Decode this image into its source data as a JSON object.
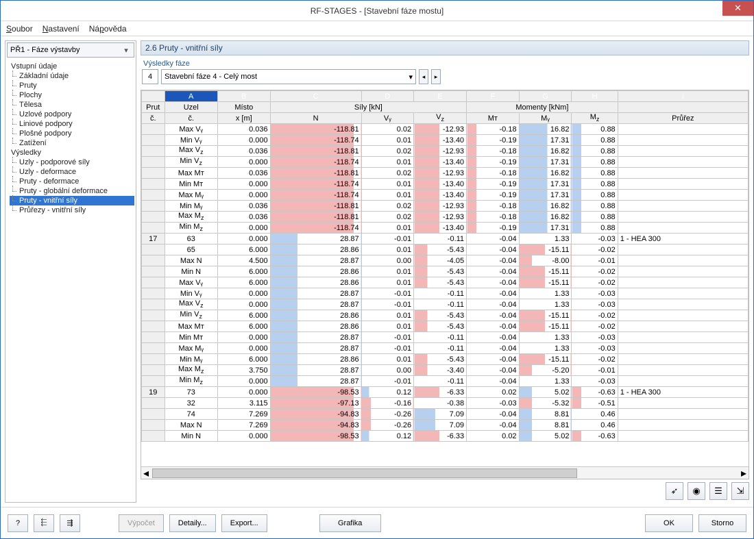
{
  "window": {
    "title": "RF-STAGES - [Stavební fáze mostu]"
  },
  "menu": {
    "file": "Soubor",
    "settings": "Nastavení",
    "help": "Nápověda"
  },
  "leftpane": {
    "combo": "PŘ1 - Fáze výstavby",
    "tree": {
      "input_root": "Vstupní údaje",
      "input_items": [
        "Základní údaje",
        "Pruty",
        "Plochy",
        "Tělesa",
        "Uzlové podpory",
        "Liniové podpory",
        "Plošné podpory",
        "Zatížení"
      ],
      "results_root": "Výsledky",
      "results_items": [
        "Uzly - podporové síly",
        "Uzly - deformace",
        "Pruty - deformace",
        "Pruty - globální deformace",
        "Pruty - vnitřní síly",
        "Průřezy - vnitřní síly"
      ],
      "selected": "Pruty - vnitřní síly"
    }
  },
  "panel": {
    "header": "2.6 Pruty - vnitřní síly",
    "phase_label": "Výsledky fáze",
    "phase_num": "4",
    "phase_name": "Stavební fáze 4 - Celý most"
  },
  "grid": {
    "colletters": [
      "A",
      "B",
      "C",
      "D",
      "E",
      "F",
      "G",
      "H",
      "I"
    ],
    "group_headers": {
      "prut": "Prut",
      "uzel": "Uzel",
      "misto": "Místo",
      "sily": "Síly [kN]",
      "momenty": "Momenty [kNm]",
      "prurez_blank": ""
    },
    "sub_headers": {
      "prut_c": "č.",
      "uzel_c": "č.",
      "misto_x": "x [m]",
      "N": "N",
      "Vy": "Vᵧ",
      "Vz": "V_z",
      "MT": "Mᴛ",
      "My": "Mᵧ",
      "Mz": "M_z",
      "prurez": "Průřez"
    },
    "rows": [
      {
        "prut": "",
        "uzel": "Max Vᵧ",
        "x": "0.036",
        "N": "-118.81",
        "Vy": "0.02",
        "Vz": "-12.93",
        "MT": "-0.18",
        "My": "16.82",
        "Mz": "0.88",
        "prurez": ""
      },
      {
        "prut": "",
        "uzel": "Min Vᵧ",
        "x": "0.000",
        "N": "-118.74",
        "Vy": "0.01",
        "Vz": "-13.40",
        "MT": "-0.19",
        "My": "17.31",
        "Mz": "0.88",
        "prurez": ""
      },
      {
        "prut": "",
        "uzel": "Max V_z",
        "x": "0.036",
        "N": "-118.81",
        "Vy": "0.02",
        "Vz": "-12.93",
        "MT": "-0.18",
        "My": "16.82",
        "Mz": "0.88",
        "prurez": ""
      },
      {
        "prut": "",
        "uzel": "Min V_z",
        "x": "0.000",
        "N": "-118.74",
        "Vy": "0.01",
        "Vz": "-13.40",
        "MT": "-0.19",
        "My": "17.31",
        "Mz": "0.88",
        "prurez": ""
      },
      {
        "prut": "",
        "uzel": "Max Mᴛ",
        "x": "0.036",
        "N": "-118.81",
        "Vy": "0.02",
        "Vz": "-12.93",
        "MT": "-0.18",
        "My": "16.82",
        "Mz": "0.88",
        "prurez": ""
      },
      {
        "prut": "",
        "uzel": "Min Mᴛ",
        "x": "0.000",
        "N": "-118.74",
        "Vy": "0.01",
        "Vz": "-13.40",
        "MT": "-0.19",
        "My": "17.31",
        "Mz": "0.88",
        "prurez": ""
      },
      {
        "prut": "",
        "uzel": "Max Mᵧ",
        "x": "0.000",
        "N": "-118.74",
        "Vy": "0.01",
        "Vz": "-13.40",
        "MT": "-0.19",
        "My": "17.31",
        "Mz": "0.88",
        "prurez": ""
      },
      {
        "prut": "",
        "uzel": "Min Mᵧ",
        "x": "0.036",
        "N": "-118.81",
        "Vy": "0.02",
        "Vz": "-12.93",
        "MT": "-0.18",
        "My": "16.82",
        "Mz": "0.88",
        "prurez": ""
      },
      {
        "prut": "",
        "uzel": "Max M_z",
        "x": "0.036",
        "N": "-118.81",
        "Vy": "0.02",
        "Vz": "-12.93",
        "MT": "-0.18",
        "My": "16.82",
        "Mz": "0.88",
        "prurez": ""
      },
      {
        "prut": "",
        "uzel": "Min M_z",
        "x": "0.000",
        "N": "-118.74",
        "Vy": "0.01",
        "Vz": "-13.40",
        "MT": "-0.19",
        "My": "17.31",
        "Mz": "0.88",
        "prurez": ""
      },
      {
        "prut": "17",
        "uzel": "63",
        "x": "0.000",
        "N": "28.87",
        "Vy": "-0.01",
        "Vz": "-0.11",
        "MT": "-0.04",
        "My": "1.33",
        "Mz": "-0.03",
        "prurez": "1 - HEA 300"
      },
      {
        "prut": "",
        "uzel": "65",
        "x": "6.000",
        "N": "28.86",
        "Vy": "0.01",
        "Vz": "-5.43",
        "MT": "-0.04",
        "My": "-15.11",
        "Mz": "-0.02",
        "prurez": ""
      },
      {
        "prut": "",
        "uzel": "Max N",
        "x": "4.500",
        "N": "28.87",
        "Vy": "0.00",
        "Vz": "-4.05",
        "MT": "-0.04",
        "My": "-8.00",
        "Mz": "-0.01",
        "prurez": ""
      },
      {
        "prut": "",
        "uzel": "Min N",
        "x": "6.000",
        "N": "28.86",
        "Vy": "0.01",
        "Vz": "-5.43",
        "MT": "-0.04",
        "My": "-15.11",
        "Mz": "-0.02",
        "prurez": ""
      },
      {
        "prut": "",
        "uzel": "Max Vᵧ",
        "x": "6.000",
        "N": "28.86",
        "Vy": "0.01",
        "Vz": "-5.43",
        "MT": "-0.04",
        "My": "-15.11",
        "Mz": "-0.02",
        "prurez": ""
      },
      {
        "prut": "",
        "uzel": "Min Vᵧ",
        "x": "0.000",
        "N": "28.87",
        "Vy": "-0.01",
        "Vz": "-0.11",
        "MT": "-0.04",
        "My": "1.33",
        "Mz": "-0.03",
        "prurez": ""
      },
      {
        "prut": "",
        "uzel": "Max V_z",
        "x": "0.000",
        "N": "28.87",
        "Vy": "-0.01",
        "Vz": "-0.11",
        "MT": "-0.04",
        "My": "1.33",
        "Mz": "-0.03",
        "prurez": ""
      },
      {
        "prut": "",
        "uzel": "Min V_z",
        "x": "6.000",
        "N": "28.86",
        "Vy": "0.01",
        "Vz": "-5.43",
        "MT": "-0.04",
        "My": "-15.11",
        "Mz": "-0.02",
        "prurez": ""
      },
      {
        "prut": "",
        "uzel": "Max Mᴛ",
        "x": "6.000",
        "N": "28.86",
        "Vy": "0.01",
        "Vz": "-5.43",
        "MT": "-0.04",
        "My": "-15.11",
        "Mz": "-0.02",
        "prurez": ""
      },
      {
        "prut": "",
        "uzel": "Min Mᴛ",
        "x": "0.000",
        "N": "28.87",
        "Vy": "-0.01",
        "Vz": "-0.11",
        "MT": "-0.04",
        "My": "1.33",
        "Mz": "-0.03",
        "prurez": ""
      },
      {
        "prut": "",
        "uzel": "Max Mᵧ",
        "x": "0.000",
        "N": "28.87",
        "Vy": "-0.01",
        "Vz": "-0.11",
        "MT": "-0.04",
        "My": "1.33",
        "Mz": "-0.03",
        "prurez": ""
      },
      {
        "prut": "",
        "uzel": "Min Mᵧ",
        "x": "6.000",
        "N": "28.86",
        "Vy": "0.01",
        "Vz": "-5.43",
        "MT": "-0.04",
        "My": "-15.11",
        "Mz": "-0.02",
        "prurez": ""
      },
      {
        "prut": "",
        "uzel": "Max M_z",
        "x": "3.750",
        "N": "28.87",
        "Vy": "0.00",
        "Vz": "-3.40",
        "MT": "-0.04",
        "My": "-5.20",
        "Mz": "-0.01",
        "prurez": ""
      },
      {
        "prut": "",
        "uzel": "Min M_z",
        "x": "0.000",
        "N": "28.87",
        "Vy": "-0.01",
        "Vz": "-0.11",
        "MT": "-0.04",
        "My": "1.33",
        "Mz": "-0.03",
        "prurez": ""
      },
      {
        "prut": "19",
        "uzel": "73",
        "x": "0.000",
        "N": "-98.53",
        "Vy": "0.12",
        "Vz": "-6.33",
        "MT": "0.02",
        "My": "5.02",
        "Mz": "-0.63",
        "prurez": "1 - HEA 300"
      },
      {
        "prut": "",
        "uzel": "32",
        "x": "3.115",
        "N": "-97.13",
        "Vy": "-0.16",
        "Vz": "-0.38",
        "MT": "-0.03",
        "My": "-5.32",
        "Mz": "-0.51",
        "prurez": ""
      },
      {
        "prut": "",
        "uzel": "74",
        "x": "7.269",
        "N": "-94.83",
        "Vy": "-0.26",
        "Vz": "7.09",
        "MT": "-0.04",
        "My": "8.81",
        "Mz": "0.46",
        "prurez": ""
      },
      {
        "prut": "",
        "uzel": "Max N",
        "x": "7.269",
        "N": "-94.83",
        "Vy": "-0.26",
        "Vz": "7.09",
        "MT": "-0.04",
        "My": "8.81",
        "Mz": "0.46",
        "prurez": ""
      },
      {
        "prut": "",
        "uzel": "Min N",
        "x": "0.000",
        "N": "-98.53",
        "Vy": "0.12",
        "Vz": "-6.33",
        "MT": "0.02",
        "My": "5.02",
        "Mz": "-0.63",
        "prurez": ""
      }
    ]
  },
  "footer": {
    "help": "?",
    "prev": "⇤",
    "next": "⇥",
    "calc": "Výpočet",
    "details": "Detaily...",
    "export": "Export...",
    "graphics": "Grafika",
    "ok": "OK",
    "cancel": "Storno"
  },
  "toolicons": [
    "✎",
    "◎",
    "≡",
    "⤴"
  ]
}
